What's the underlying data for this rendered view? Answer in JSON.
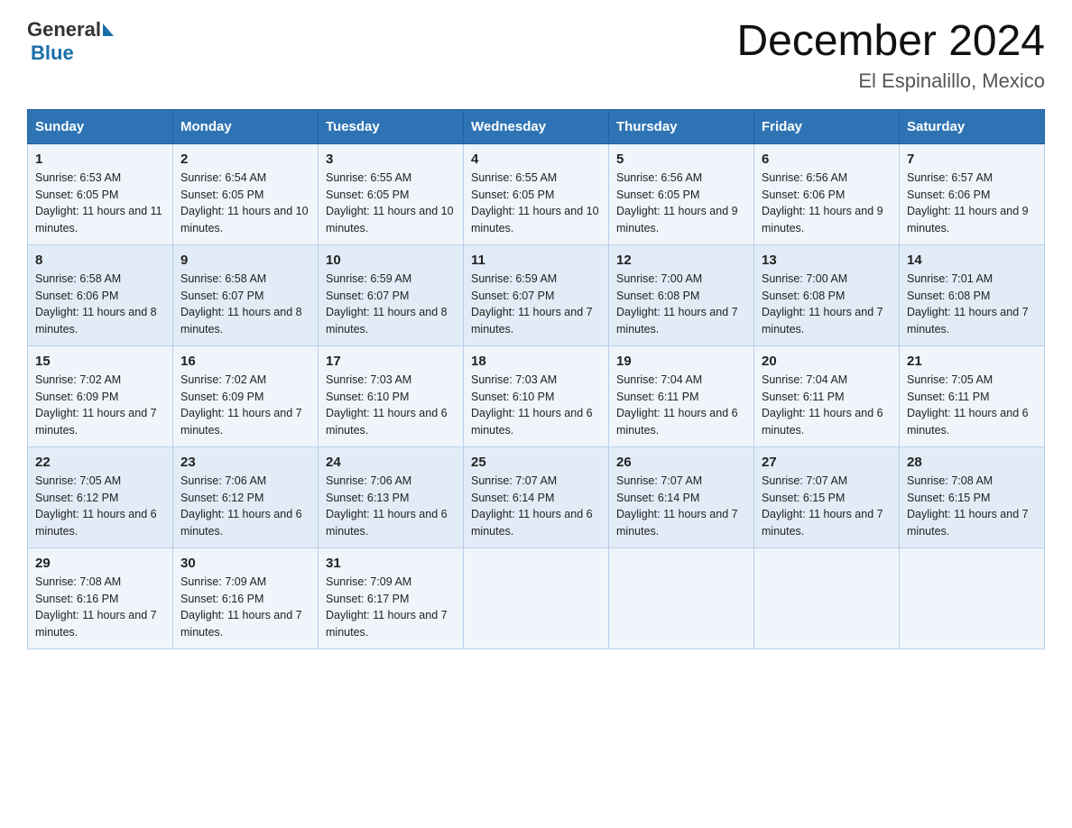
{
  "logo": {
    "general": "General",
    "blue": "Blue"
  },
  "title": "December 2024",
  "subtitle": "El Espinalillo, Mexico",
  "weekdays": [
    "Sunday",
    "Monday",
    "Tuesday",
    "Wednesday",
    "Thursday",
    "Friday",
    "Saturday"
  ],
  "weeks": [
    [
      {
        "day": "1",
        "sunrise": "6:53 AM",
        "sunset": "6:05 PM",
        "daylight": "11 hours and 11 minutes."
      },
      {
        "day": "2",
        "sunrise": "6:54 AM",
        "sunset": "6:05 PM",
        "daylight": "11 hours and 10 minutes."
      },
      {
        "day": "3",
        "sunrise": "6:55 AM",
        "sunset": "6:05 PM",
        "daylight": "11 hours and 10 minutes."
      },
      {
        "day": "4",
        "sunrise": "6:55 AM",
        "sunset": "6:05 PM",
        "daylight": "11 hours and 10 minutes."
      },
      {
        "day": "5",
        "sunrise": "6:56 AM",
        "sunset": "6:05 PM",
        "daylight": "11 hours and 9 minutes."
      },
      {
        "day": "6",
        "sunrise": "6:56 AM",
        "sunset": "6:06 PM",
        "daylight": "11 hours and 9 minutes."
      },
      {
        "day": "7",
        "sunrise": "6:57 AM",
        "sunset": "6:06 PM",
        "daylight": "11 hours and 9 minutes."
      }
    ],
    [
      {
        "day": "8",
        "sunrise": "6:58 AM",
        "sunset": "6:06 PM",
        "daylight": "11 hours and 8 minutes."
      },
      {
        "day": "9",
        "sunrise": "6:58 AM",
        "sunset": "6:07 PM",
        "daylight": "11 hours and 8 minutes."
      },
      {
        "day": "10",
        "sunrise": "6:59 AM",
        "sunset": "6:07 PM",
        "daylight": "11 hours and 8 minutes."
      },
      {
        "day": "11",
        "sunrise": "6:59 AM",
        "sunset": "6:07 PM",
        "daylight": "11 hours and 7 minutes."
      },
      {
        "day": "12",
        "sunrise": "7:00 AM",
        "sunset": "6:08 PM",
        "daylight": "11 hours and 7 minutes."
      },
      {
        "day": "13",
        "sunrise": "7:00 AM",
        "sunset": "6:08 PM",
        "daylight": "11 hours and 7 minutes."
      },
      {
        "day": "14",
        "sunrise": "7:01 AM",
        "sunset": "6:08 PM",
        "daylight": "11 hours and 7 minutes."
      }
    ],
    [
      {
        "day": "15",
        "sunrise": "7:02 AM",
        "sunset": "6:09 PM",
        "daylight": "11 hours and 7 minutes."
      },
      {
        "day": "16",
        "sunrise": "7:02 AM",
        "sunset": "6:09 PM",
        "daylight": "11 hours and 7 minutes."
      },
      {
        "day": "17",
        "sunrise": "7:03 AM",
        "sunset": "6:10 PM",
        "daylight": "11 hours and 6 minutes."
      },
      {
        "day": "18",
        "sunrise": "7:03 AM",
        "sunset": "6:10 PM",
        "daylight": "11 hours and 6 minutes."
      },
      {
        "day": "19",
        "sunrise": "7:04 AM",
        "sunset": "6:11 PM",
        "daylight": "11 hours and 6 minutes."
      },
      {
        "day": "20",
        "sunrise": "7:04 AM",
        "sunset": "6:11 PM",
        "daylight": "11 hours and 6 minutes."
      },
      {
        "day": "21",
        "sunrise": "7:05 AM",
        "sunset": "6:11 PM",
        "daylight": "11 hours and 6 minutes."
      }
    ],
    [
      {
        "day": "22",
        "sunrise": "7:05 AM",
        "sunset": "6:12 PM",
        "daylight": "11 hours and 6 minutes."
      },
      {
        "day": "23",
        "sunrise": "7:06 AM",
        "sunset": "6:12 PM",
        "daylight": "11 hours and 6 minutes."
      },
      {
        "day": "24",
        "sunrise": "7:06 AM",
        "sunset": "6:13 PM",
        "daylight": "11 hours and 6 minutes."
      },
      {
        "day": "25",
        "sunrise": "7:07 AM",
        "sunset": "6:14 PM",
        "daylight": "11 hours and 6 minutes."
      },
      {
        "day": "26",
        "sunrise": "7:07 AM",
        "sunset": "6:14 PM",
        "daylight": "11 hours and 7 minutes."
      },
      {
        "day": "27",
        "sunrise": "7:07 AM",
        "sunset": "6:15 PM",
        "daylight": "11 hours and 7 minutes."
      },
      {
        "day": "28",
        "sunrise": "7:08 AM",
        "sunset": "6:15 PM",
        "daylight": "11 hours and 7 minutes."
      }
    ],
    [
      {
        "day": "29",
        "sunrise": "7:08 AM",
        "sunset": "6:16 PM",
        "daylight": "11 hours and 7 minutes."
      },
      {
        "day": "30",
        "sunrise": "7:09 AM",
        "sunset": "6:16 PM",
        "daylight": "11 hours and 7 minutes."
      },
      {
        "day": "31",
        "sunrise": "7:09 AM",
        "sunset": "6:17 PM",
        "daylight": "11 hours and 7 minutes."
      },
      null,
      null,
      null,
      null
    ]
  ],
  "labels": {
    "sunrise": "Sunrise:",
    "sunset": "Sunset:",
    "daylight": "Daylight:"
  }
}
